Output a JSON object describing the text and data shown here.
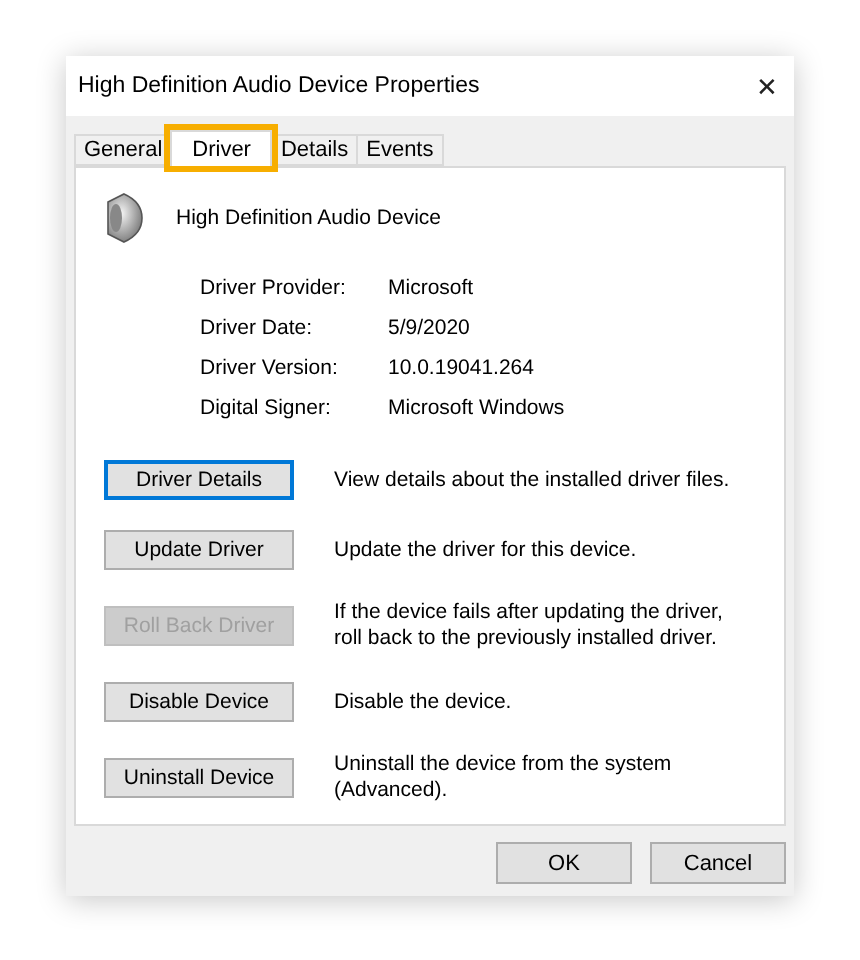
{
  "window": {
    "title": "High Definition Audio Device Properties",
    "close": "✕"
  },
  "tabs": [
    {
      "label": "General",
      "selected": false,
      "highlighted": false
    },
    {
      "label": "Driver",
      "selected": true,
      "highlighted": true
    },
    {
      "label": "Details",
      "selected": false,
      "highlighted": false
    },
    {
      "label": "Events",
      "selected": false,
      "highlighted": false
    }
  ],
  "device": {
    "name": "High Definition Audio Device"
  },
  "properties": [
    {
      "label": "Driver Provider:",
      "value": "Microsoft"
    },
    {
      "label": "Driver Date:",
      "value": "5/9/2020"
    },
    {
      "label": "Driver Version:",
      "value": "10.0.19041.264"
    },
    {
      "label": "Digital Signer:",
      "value": "Microsoft Windows"
    }
  ],
  "actions": [
    {
      "button": "Driver Details",
      "description": "View details about the installed driver files.",
      "disabled": false,
      "focused": true
    },
    {
      "button": "Update Driver",
      "description": "Update the driver for this device.",
      "disabled": false,
      "focused": false
    },
    {
      "button": "Roll Back Driver",
      "description": "If the device fails after updating the driver, roll back to the previously installed driver.",
      "disabled": true,
      "focused": false
    },
    {
      "button": "Disable Device",
      "description": "Disable the device.",
      "disabled": false,
      "focused": false
    },
    {
      "button": "Uninstall Device",
      "description": "Uninstall the device from the system (Advanced).",
      "disabled": false,
      "focused": false
    }
  ],
  "footer_buttons": [
    "OK",
    "Cancel"
  ]
}
